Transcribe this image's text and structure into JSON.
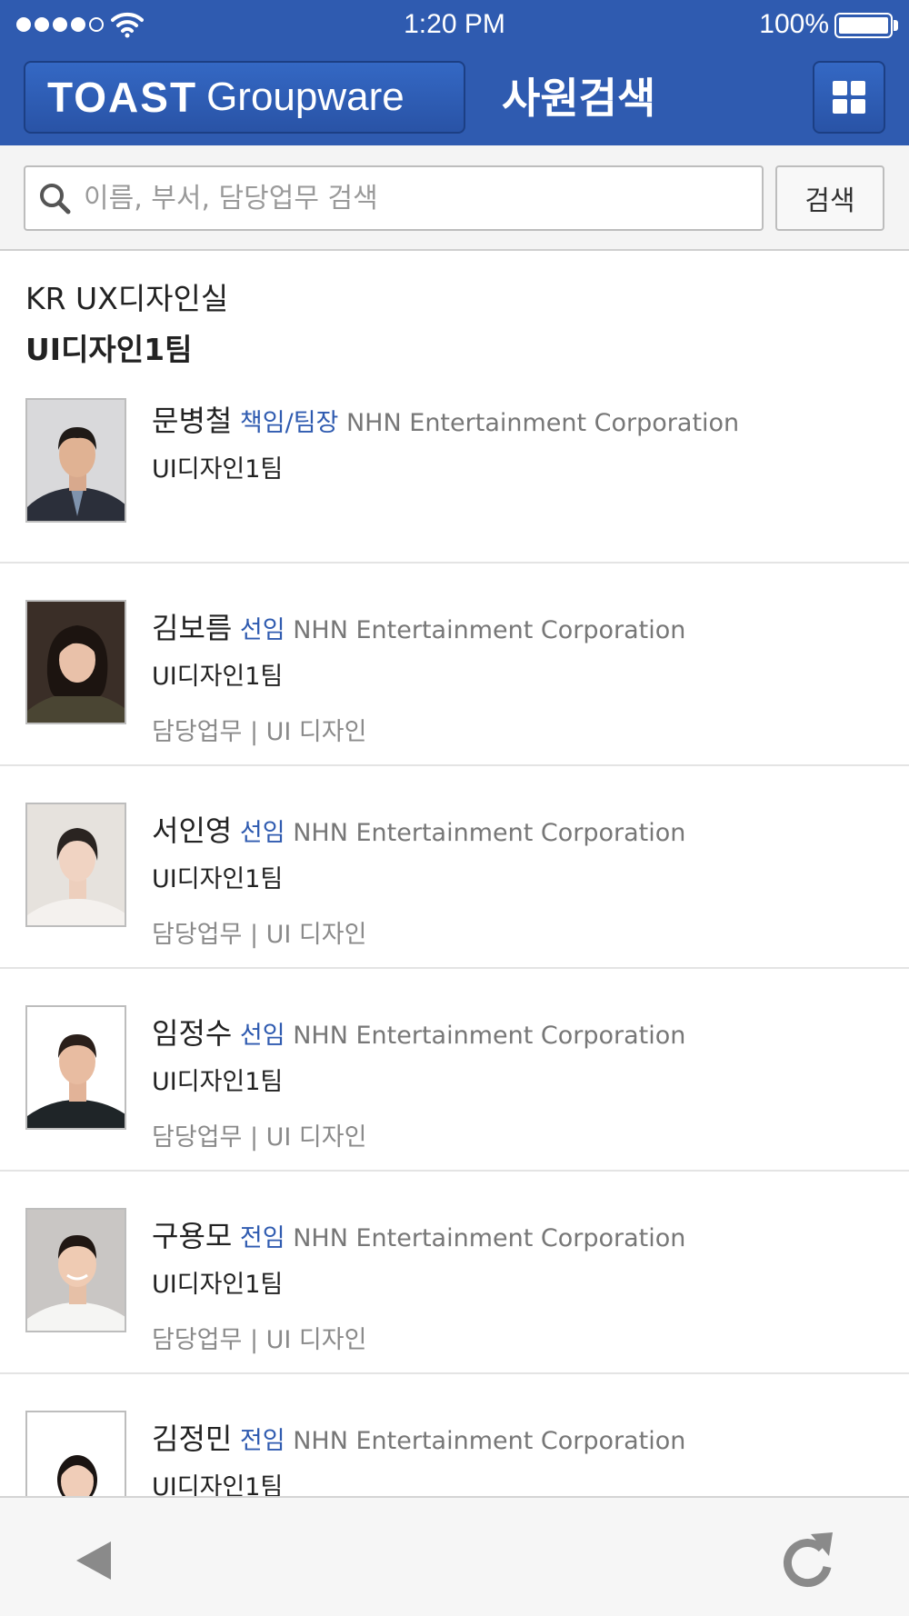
{
  "status_bar": {
    "time": "1:20 PM",
    "battery": "100%"
  },
  "header": {
    "logo_brand": "TOAST",
    "logo_product": "Groupware",
    "title": "사원검색"
  },
  "search": {
    "placeholder": "이름, 부서, 담당업무 검색",
    "value": "",
    "button_label": "검색"
  },
  "department": {
    "name": "KR UX디자인실",
    "team": "UI디자인1팀"
  },
  "employees": [
    {
      "name": "문병철",
      "title": "책임/팀장",
      "company": "NHN Entertainment Corporation",
      "team": "UI디자인1팀",
      "duty": ""
    },
    {
      "name": "김보름",
      "title": "선임",
      "company": "NHN Entertainment Corporation",
      "team": "UI디자인1팀",
      "duty": "담당업무 | UI 디자인"
    },
    {
      "name": "서인영",
      "title": "선임",
      "company": "NHN Entertainment Corporation",
      "team": "UI디자인1팀",
      "duty": "담당업무 | UI 디자인"
    },
    {
      "name": "임정수",
      "title": "선임",
      "company": "NHN Entertainment Corporation",
      "team": "UI디자인1팀",
      "duty": "담당업무 | UI 디자인"
    },
    {
      "name": "구용모",
      "title": "전임",
      "company": "NHN Entertainment Corporation",
      "team": "UI디자인1팀",
      "duty": "담당업무 | UI 디자인"
    },
    {
      "name": "김정민",
      "title": "전임",
      "company": "NHN Entertainment Corporation",
      "team": "UI디자인1팀",
      "duty": ""
    }
  ],
  "icons": {
    "search": "search-icon",
    "menu": "grid-menu-icon",
    "back": "back-arrow-icon",
    "refresh": "refresh-icon",
    "wifi": "wifi-icon",
    "battery": "battery-icon"
  },
  "colors": {
    "brand": "#2f5bb0",
    "title_accent": "#2f5bb0",
    "muted": "#8a8a8a"
  }
}
